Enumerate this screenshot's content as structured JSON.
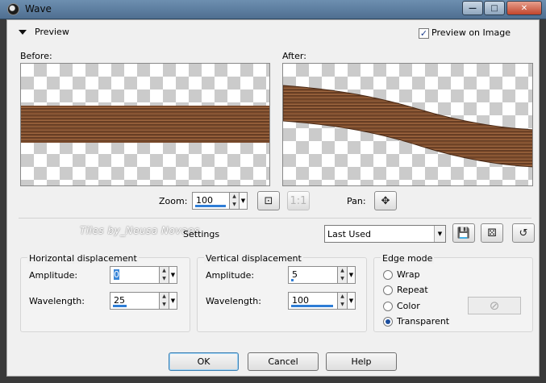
{
  "window": {
    "title": "Wave"
  },
  "preview": {
    "section_label": "Preview",
    "preview_on_image_label": "Preview on Image",
    "preview_on_image_checked": true
  },
  "canvases": {
    "before_label": "Before:",
    "after_label": "After:"
  },
  "zoom": {
    "label": "Zoom:",
    "value": "100",
    "pan_label": "Pan:"
  },
  "settings": {
    "watermark_text": "Tiles by_Neusa Novaes",
    "label": "Settings",
    "preset_value": "Last Used"
  },
  "horizontal": {
    "title": "Horizontal displacement",
    "amplitude_label": "Amplitude:",
    "amplitude_value": "0",
    "wavelength_label": "Wavelength:",
    "wavelength_value": "25"
  },
  "vertical": {
    "title": "Vertical displacement",
    "amplitude_label": "Amplitude:",
    "amplitude_value": "5",
    "wavelength_label": "Wavelength:",
    "wavelength_value": "100"
  },
  "edge_mode": {
    "title": "Edge mode",
    "options": [
      "Wrap",
      "Repeat",
      "Color",
      "Transparent"
    ],
    "selected": "Transparent"
  },
  "buttons": {
    "ok": "OK",
    "cancel": "Cancel",
    "help": "Help"
  },
  "icons": {
    "preview_toggle": "triangle-down-icon",
    "zoom_fit": "zoom-fit-icon",
    "zoom_actual": "actual-size-icon",
    "pan": "move-icon",
    "save_preset": "save-icon",
    "randomize": "dice-icon",
    "reset": "reset-icon",
    "color_none": "no-color-icon"
  }
}
